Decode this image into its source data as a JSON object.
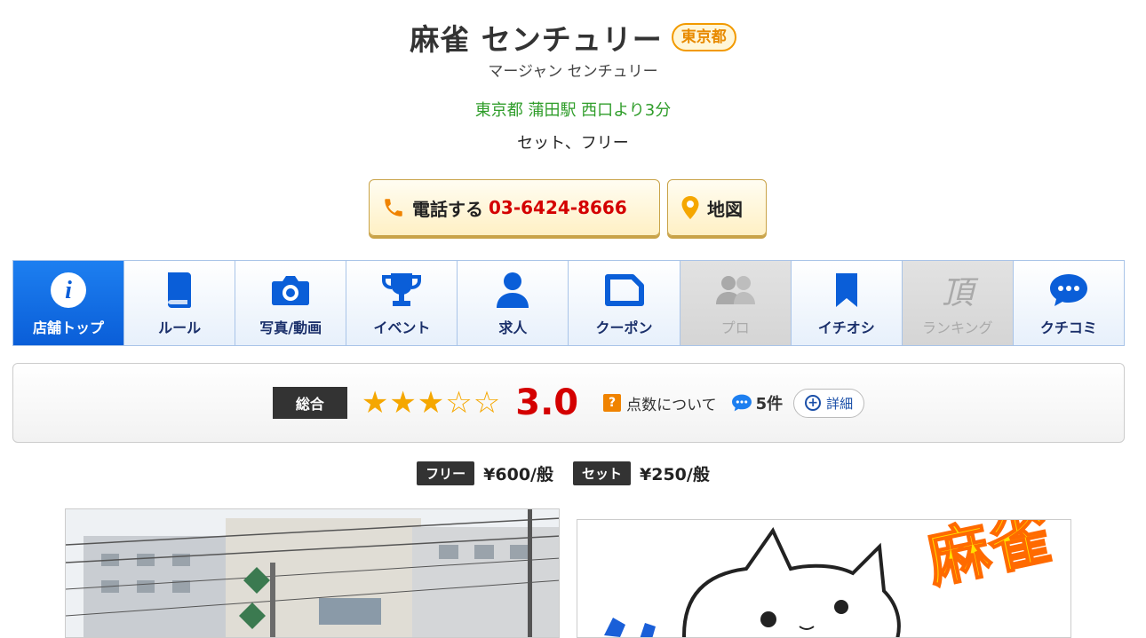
{
  "shop": {
    "name": "麻雀 センチュリー",
    "prefecture_badge": "東京都",
    "reading": "マージャン センチュリー",
    "access": "東京都 蒲田駅 西口より3分",
    "types": "セット、フリー"
  },
  "actions": {
    "call_label": "電話する",
    "phone": "03-6424-8666",
    "map_label": "地図"
  },
  "tabs": [
    {
      "label": "店舗トップ",
      "icon": "info-icon",
      "state": "active"
    },
    {
      "label": "ルール",
      "icon": "book-icon",
      "state": "normal"
    },
    {
      "label": "写真/動画",
      "icon": "camera-icon",
      "state": "normal"
    },
    {
      "label": "イベント",
      "icon": "trophy-icon",
      "state": "normal"
    },
    {
      "label": "求人",
      "icon": "person-icon",
      "state": "normal"
    },
    {
      "label": "クーポン",
      "icon": "coupon-icon",
      "state": "normal"
    },
    {
      "label": "プロ",
      "icon": "pro-people-icon",
      "state": "disabled"
    },
    {
      "label": "イチオシ",
      "icon": "bookmark-icon",
      "state": "normal"
    },
    {
      "label": "ランキング",
      "icon": "ranking-kanji-icon",
      "state": "disabled"
    },
    {
      "label": "クチコミ",
      "icon": "chat-bubble-icon",
      "state": "normal"
    }
  ],
  "ranking_glyph": "頂",
  "rating": {
    "label": "総合",
    "stars_filled": 3,
    "stars_total": 5,
    "stars_text": "★★★☆☆",
    "score": "3.0",
    "help_mark": "?",
    "help_label": "点数について",
    "review_count": "5件",
    "detail_label": "詳細"
  },
  "prices": [
    {
      "tag": "フリー",
      "value": "¥600/般"
    },
    {
      "tag": "セット",
      "value": "¥250/般"
    }
  ],
  "illustration_text": "麻雀",
  "colors": {
    "accent_blue": "#0a5ed8",
    "phone_red": "#d40000",
    "star_gold": "#f5a700",
    "access_green": "#2f9d2a",
    "badge_orange": "#f29a00"
  }
}
